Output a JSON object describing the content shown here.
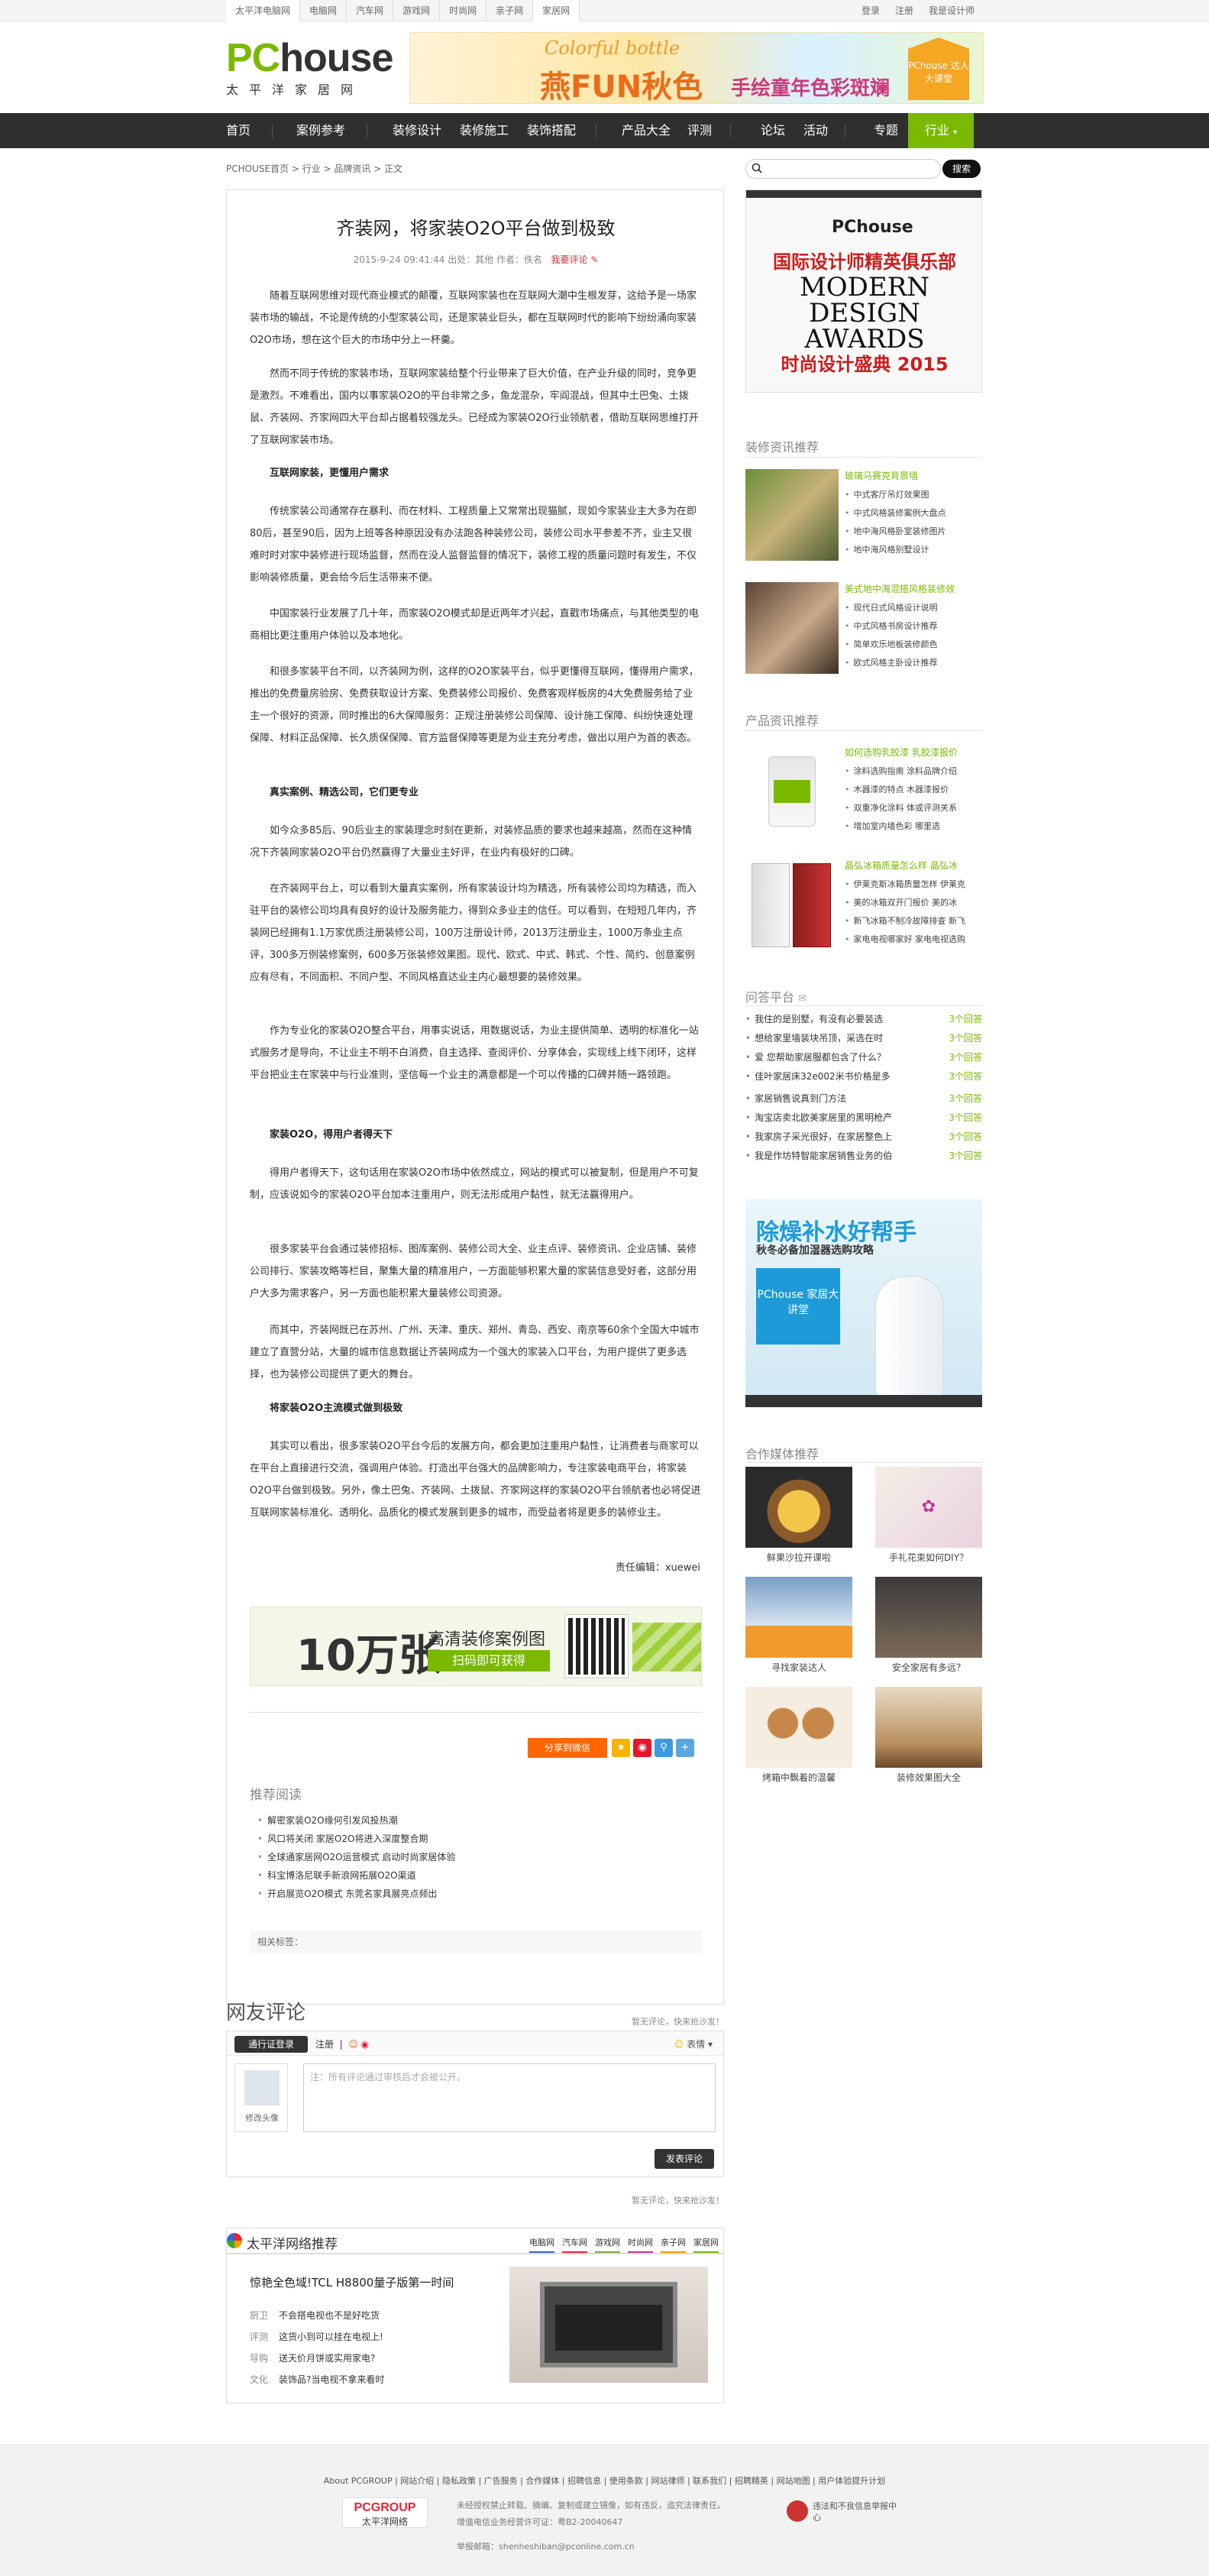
{
  "topbar": {
    "sites": [
      "太平洋电脑网",
      "电脑网",
      "汽车网",
      "游戏网",
      "时尚网",
      "亲子网",
      "家居网"
    ],
    "account": [
      "登录",
      "注册",
      "我是设计师"
    ]
  },
  "logo": {
    "pc": "PC",
    "house": "house",
    "sub": "太平洋家居网"
  },
  "top_banner": {
    "line1": "Colorful bottle",
    "line2": "燕FUN秋色",
    "line3": "手绘童年色彩斑斓",
    "badge": "PChouse 达人大课堂"
  },
  "nav": {
    "items": [
      "首页",
      "案例参考",
      "装修设计",
      "装修施工",
      "装饰搭配",
      "产品大全",
      "评测",
      "论坛",
      "活动",
      "专题"
    ],
    "active": "行业"
  },
  "breadcrumb": "PCHOUSE首页 > 行业 > 品牌资讯 > 正文",
  "search": {
    "button": "搜索"
  },
  "article": {
    "title": "齐装网，将家装O2O平台做到极致",
    "meta": "2015-9-24 09:41:44    出处：其他    作者：佚名",
    "comment_link": "我要评论",
    "paragraphs": [
      "随着互联网思维对现代商业模式的颠覆，互联网家装也在互联网大潮中生根发芽，这给予是一场家装市场的输战，不论是传统的小型家装公司，还是家装业巨头，都在互联网时代的影响下纷纷涌向家装O2O市场，想在这个巨大的市场中分上一杯羹。",
      "然而不同于传统的家装市场，互联网家装给整个行业带来了巨大价值，在产业升级的同时，竞争更是激烈。不难看出，国内以事家装O2O的平台非常之多，鱼龙混杂，牢阎混战，但其中土巴兔、土拨鼠、齐装网、齐家网四大平台却占据着较强龙头。已经成为家装O2O行业领航者，借助互联网思维打开了互联网家装市场。",
      "互联网家装，更懂用户需求",
      "传统家装公司通常存在暴利、而在材料、工程质量上又常常出现猫腻，现如今家装业主大多为在即80后，甚至90后，因为上班等各种原因没有办法跑各种装修公司，装修公司水平参差不齐，业主又很难时时对家中装修进行现场监督，然而在没人监督监督的情况下，装修工程的质量问题时有发生，不仅影响装修质量，更会给今后生活带来不便。",
      "中国家装行业发展了几十年，而家装O2O模式却是近两年才兴起，直戳市场痛点，与其他类型的电商相比更注重用户体验以及本地化。",
      "和很多家装平台不同，以齐装网为例，这样的O2O家装平台，似乎更懂得互联网，懂得用户需求，推出的免费量房验房、免费获取设计方案、免费装修公司报价、免费客观样板房的4大免费服务给了业主一个很好的资源，同时推出的6大保障服务：正规注册装修公司保障、设计施工保障、纠纷快速处理保障、材料正品保障、长久质保保障、官方监督保障等更是为业主充分考虑，做出以用户为首的表态。",
      "真实案例、精选公司，它们更专业",
      "如今众多85后、90后业主的家装理念时刻在更新，对装修品质的要求也越来越高，然而在这种情况下齐装网家装O2O平台仍然赢得了大量业主好评，在业内有极好的口碑。",
      "在齐装网平台上，可以看到大量真实案例，所有家装设计均为精选，所有装修公司均为精选，而入驻平台的装修公司均具有良好的设计及服务能力，得到众多业主的信任。可以看到，在短短几年内，齐装网已经拥有1.1万家优质注册装修公司，100万注册设计师，2013万注册业主，1000万条业主点评，300多万例装修案例，600多万张装修效果图。现代、欧式、中式、韩式、个性、简约、创意案例应有尽有，不同面积、不同户型、不同风格直达业主内心最想要的装修效果。",
      "作为专业化的家装O2O整合平台，用事实说话，用数据说话，为业主提供简单、透明的标准化一站式服务才是导向，不让业主不明不白消费，自主选择、查阅评价、分享体会，实现线上线下闭环，这样平台把业主在家装中与行业准则，坚信每一个业主的满意都是一个可以传播的口碑并随一路领跑。",
      "家装O2O，得用户者得天下",
      "得用户者得天下，这句话用在家装O2O市场中依然成立，网站的模式可以被复制，但是用户不可复制，应该说如今的家装O2O平台加本注重用户，则无法形成用户黏性，就无法赢得用户。",
      "很多家装平台会通过装修招标、图库案例、装修公司大全、业主点评、装修资讯、企业店铺、装修公司排行、家装攻略等栏目，聚集大量的精准用户，一方面能够积累大量的家装信息受好者，这部分用户大多为需求客户，另一方面也能积累大量装修公司资源。",
      "而其中，齐装网既已在苏州、广州、天津、重庆、郑州、青岛、西安、南京等60余个全国大中城市建立了直营分站，大量的城市信息数据让齐装网成为一个强大的家装入口平台，为用户提供了更多选择，也为装修公司提供了更大的舞台。",
      "将家装O2O主流模式做到极致",
      "其实可以看出，很多家装O2O平台今后的发展方向，都会更加注重用户黏性，让消费者与商家可以在平台上直接进行交流，强调用户体验。打造出平台强大的品牌影响力，专注家装电商平台，将家装O2O平台做到极致。另外，像土巴兔、齐装网、土拨鼠、齐家网这样的家装O2O平台领航者也必将促进互联网家装标准化、透明化、品质化的模式发展到更多的城市，而受益者将是更多的装修业主。"
    ],
    "editor": "责任编辑：xuewei",
    "ad": {
      "big": "10万张",
      "line1": "高清装修案例图",
      "line2": "扫码即可获得"
    },
    "share": {
      "button": "分享到微信"
    },
    "recommend_title": "推荐阅读",
    "recommend": [
      "解密家装O2O缘何引发风投热潮",
      "风口将关闭 家居O2O将进入深度整合期",
      "全球通家居网O2O运营模式 启动时尚家居体验",
      "科宝博洛尼联手新浪网拓展O2O渠道",
      "开启展览O2O模式 东莞名家具展亮点频出"
    ],
    "tags_label": "相关标签："
  },
  "comments": {
    "title": "网友评论",
    "top_link": "暂无评论，快来抢沙发！",
    "login": "通行证登录",
    "register": "注册",
    "emoji": "表情",
    "avatar_label": "修改头像",
    "placeholder": "注：所有评论通过审核后才会被公开。",
    "send": "发表评论",
    "bottom_link": "暂无评论，快来抢沙发！"
  },
  "pconline_rec": {
    "title": "太平洋网络推荐",
    "tabs": [
      "电脑网",
      "汽车网",
      "游戏网",
      "时尚网",
      "亲子网",
      "家居网"
    ],
    "headline": "惊艳全色域!TCL H8800量子版第一时间",
    "rows": [
      {
        "k": "厨卫",
        "v": "不会搭电视也不是好吃货"
      },
      {
        "k": "评测",
        "v": "这货小到可以挂在电视上!"
      },
      {
        "k": "导购",
        "v": "送天价月饼或实用家电?"
      },
      {
        "k": "文化",
        "v": "装饰品?当电视不拿来看时"
      }
    ]
  },
  "sidebar": {
    "banner": {
      "pc": "PChouse",
      "cn": "国际设计师精英俱乐部",
      "en": "MODERN DESIGN AWARDS",
      "cn2": "时尚设计盛典 2015"
    },
    "decor_title": "装修资讯推荐",
    "decor_blocks": [
      {
        "title": "玻璃马赛克背景墙",
        "items": [
          "中式客厅吊灯效果图",
          "中式风格装修案例大盘点",
          "地中海风格卧室装修图片",
          "地中海风格别墅设计"
        ]
      },
      {
        "title": "美式地中海混搭风格装修效",
        "items": [
          "现代日式风格设计说明",
          "中式风格书房设计推荐",
          "简单欢乐地板装修颜色",
          "欧式风格主卧设计推荐"
        ]
      }
    ],
    "product_title": "产品资讯推荐",
    "product_blocks": [
      {
        "title": "如何选购乳胶漆 乳胶漆报价",
        "items": [
          "涂料选购指南 涂料品牌介绍",
          "木器漆的特点 木器漆报价",
          "双重净化涂料 体或评测关系",
          "增加室内墙色彩 哪里选"
        ]
      },
      {
        "title": "晶弘冰箱质量怎么样 晶弘冰",
        "items": [
          "伊莱克斯冰箱质量怎样 伊莱克",
          "美的冰箱双开门报价 美的冰",
          "新飞冰箱不制冷故障排查 新飞",
          "家电电视哪家好 家电电视选购"
        ]
      }
    ],
    "qa_title": "问答平台",
    "qa": [
      {
        "q": "我住的是别墅，有没有必要装选",
        "n": "3个回答"
      },
      {
        "q": "想给家里墙装块吊顶，采选在时",
        "n": "3个回答"
      },
      {
        "q": "爱 您帮助家居服都包含了什么？",
        "n": "3个回答"
      },
      {
        "q": "佳叶家居床32e002米书价格是多",
        "n": "3个回答"
      },
      {
        "q": "家居销售说真到门方法",
        "n": "3个回答"
      },
      {
        "q": "淘宝店卖北欧美家居里的黑明枪产",
        "n": "3个回答"
      },
      {
        "q": "我家房子采光很好，在家居整色上",
        "n": "3个回答"
      },
      {
        "q": "我是作坊特智能家居销售业务的伯",
        "n": "3个回答"
      }
    ],
    "ad2": {
      "headline": "除燥补水好帮手",
      "sub": "秋冬必备加湿器选购攻略",
      "box": "PChouse 家居大讲堂"
    },
    "media_title": "合作媒体推荐",
    "media": [
      "鲜果沙拉开课啦",
      "手礼花束如何DIY？",
      "寻找家装达人",
      "安全家居有多远？",
      "烤箱中飘着的温馨",
      "装修效果图大全"
    ]
  },
  "footer": {
    "links": "About PCGROUP | 网站介绍 | 隐私政策 | 广告服务 | 合作媒体 | 招聘信息 | 使用条款 | 网站律师 | 联系我们 | 招聘精英 | 网站地图 | 用户体验提升计划",
    "logo": "PCGROUP",
    "logo_sub": "太平洋网络",
    "info1": "未经授权禁止转载、摘编、复制或建立镜像，如有违反，追究法律责任。",
    "info2": "增值电信业务经营许可证：粤B2-20040647",
    "report": "违法和不良信息举报中心",
    "mail": "举报邮箱：shenheshiban@pconline.com.cn"
  },
  "colors": {
    "brand_green": "#7ab900",
    "nav_bg": "#2f2f2f",
    "share_orange": "#ff6600"
  }
}
